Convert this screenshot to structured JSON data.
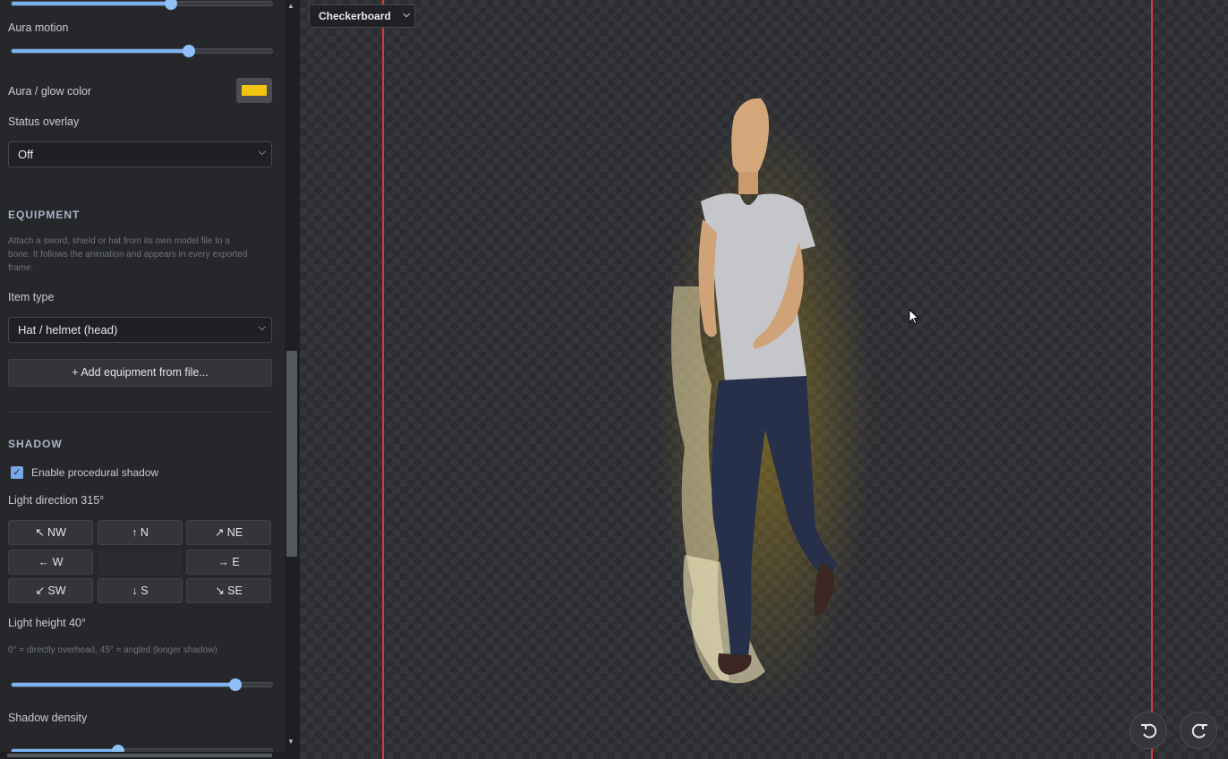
{
  "sidebar": {
    "aura_motion_label": "Aura motion",
    "aura_motion_value": 0.68,
    "top_slider_value": 0.61,
    "aura_color_label": "Aura / glow color",
    "aura_color": "#f2c40f",
    "status_overlay_label": "Status overlay",
    "status_overlay_value": "Off",
    "equipment": {
      "title": "EQUIPMENT",
      "help_line1": "Attach a sword, shield or hat from its own model file to a",
      "help_line2": "bone. It follows the animation and appears in every exported",
      "help_line3": "frame.",
      "item_type_label": "Item type",
      "item_type_value": "Hat / helmet (head)",
      "add_button": "+ Add equipment from file..."
    },
    "shadow": {
      "title": "SHADOW",
      "enable_label": "Enable procedural shadow",
      "enabled": true,
      "light_direction_label": "Light direction 315°",
      "directions": {
        "nw": "↖ NW",
        "n": "↑ N",
        "ne": "↗ NE",
        "w": "← W",
        "e": "→ E",
        "sw": "↙ SW",
        "s": "↓ S",
        "se": "↘ SE"
      },
      "light_height_label": "Light height 40°",
      "light_height_help": "0° = directly overhead, 45° = angled (longer shadow)",
      "light_height_value": 0.86,
      "density_label": "Shadow density"
    }
  },
  "viewport": {
    "background_select": "Checkerboard",
    "guide_color": "#d23b3b"
  }
}
